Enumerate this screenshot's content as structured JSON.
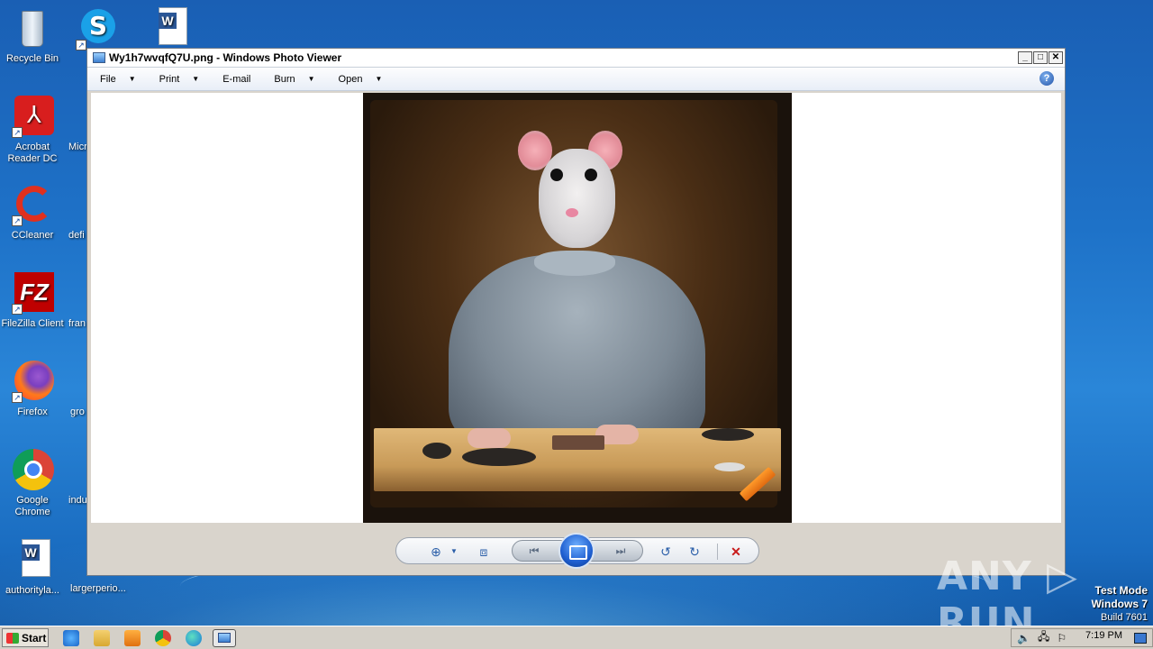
{
  "desktop": {
    "icons": [
      {
        "label": "Recycle Bin",
        "icon": "recycle-bin-icon"
      },
      {
        "label": "Acrobat Reader DC",
        "icon": "acrobat-icon"
      },
      {
        "label": "CCleaner",
        "icon": "ccleaner-icon"
      },
      {
        "label": "FileZilla Client",
        "icon": "filezilla-icon"
      },
      {
        "label": "Firefox",
        "icon": "firefox-icon"
      },
      {
        "label": "Google Chrome",
        "icon": "chrome-icon"
      },
      {
        "label": "authorityla...",
        "icon": "word-doc-icon"
      }
    ],
    "cut_labels": [
      "Micr",
      "defi",
      "fran",
      "gro",
      "indu",
      "largerperio..."
    ]
  },
  "window": {
    "title": "Wy1h7wvqfQ7U.png - Windows Photo Viewer",
    "menu": [
      {
        "label": "File",
        "has_dropdown": true
      },
      {
        "label": "Print",
        "has_dropdown": true
      },
      {
        "label": "E-mail",
        "has_dropdown": false
      },
      {
        "label": "Burn",
        "has_dropdown": true
      },
      {
        "label": "Open",
        "has_dropdown": true
      }
    ],
    "help_glyph": "?",
    "controls": {
      "minimize": "_",
      "maximize": "□",
      "close": "✕"
    }
  },
  "toolbar": {
    "zoom_icon": "⊕",
    "actual_size_icon": "⧈",
    "prev_icon": "⏮",
    "slideshow_icon": "slideshow-icon",
    "next_icon": "⏭",
    "rotate_ccw_icon": "↺",
    "rotate_cw_icon": "↻",
    "delete_icon": "✕"
  },
  "watermark": "ANY ▷ RUN",
  "os_info": {
    "line1": "Test Mode",
    "line2": "Windows 7",
    "line3": "Build 7601"
  },
  "taskbar": {
    "start_label": "Start",
    "clock": "7:19 PM"
  }
}
